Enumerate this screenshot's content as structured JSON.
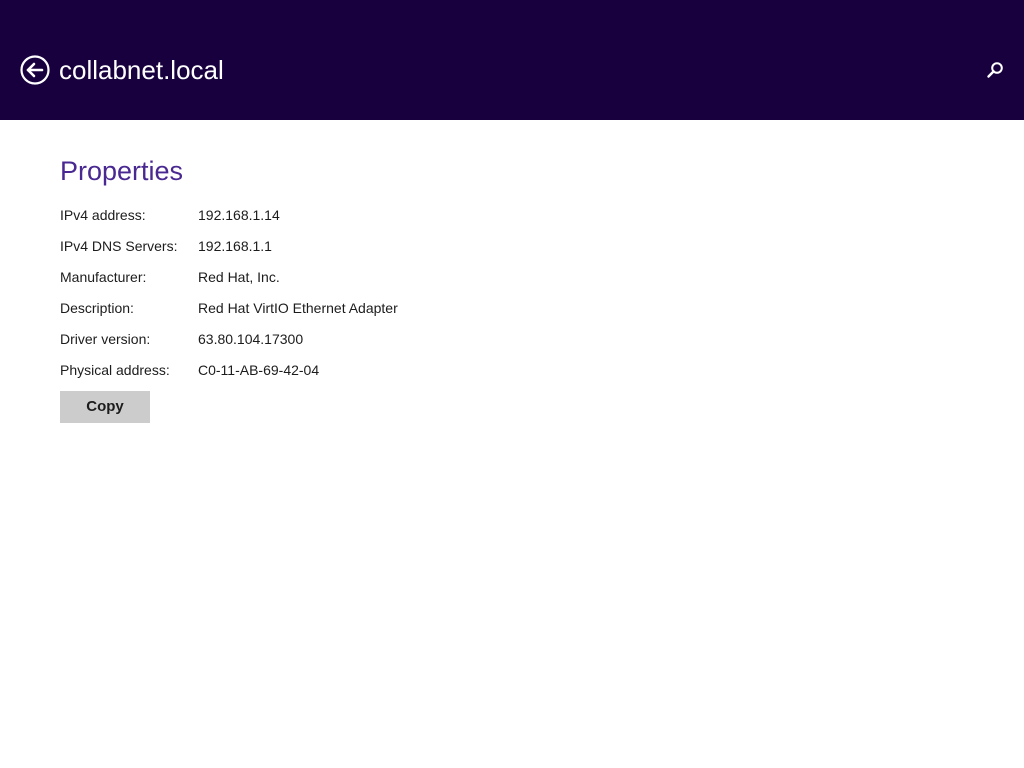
{
  "header": {
    "title": "collabnet.local",
    "background_color": "#18003f",
    "back_icon": "back-arrow-circle-icon",
    "search_icon": "search-icon"
  },
  "properties": {
    "heading": "Properties",
    "heading_color": "#4a2891",
    "rows": [
      {
        "label": "IPv4 address:",
        "value": "192.168.1.14"
      },
      {
        "label": "IPv4 DNS Servers:",
        "value": "192.168.1.1"
      },
      {
        "label": "Manufacturer:",
        "value": "Red Hat, Inc."
      },
      {
        "label": "Description:",
        "value": "Red Hat VirtIO Ethernet Adapter"
      },
      {
        "label": "Driver version:",
        "value": "63.80.104.17300"
      },
      {
        "label": "Physical address:",
        "value": "C0-11-AB-69-42-04"
      }
    ],
    "copy_label": "Copy"
  }
}
